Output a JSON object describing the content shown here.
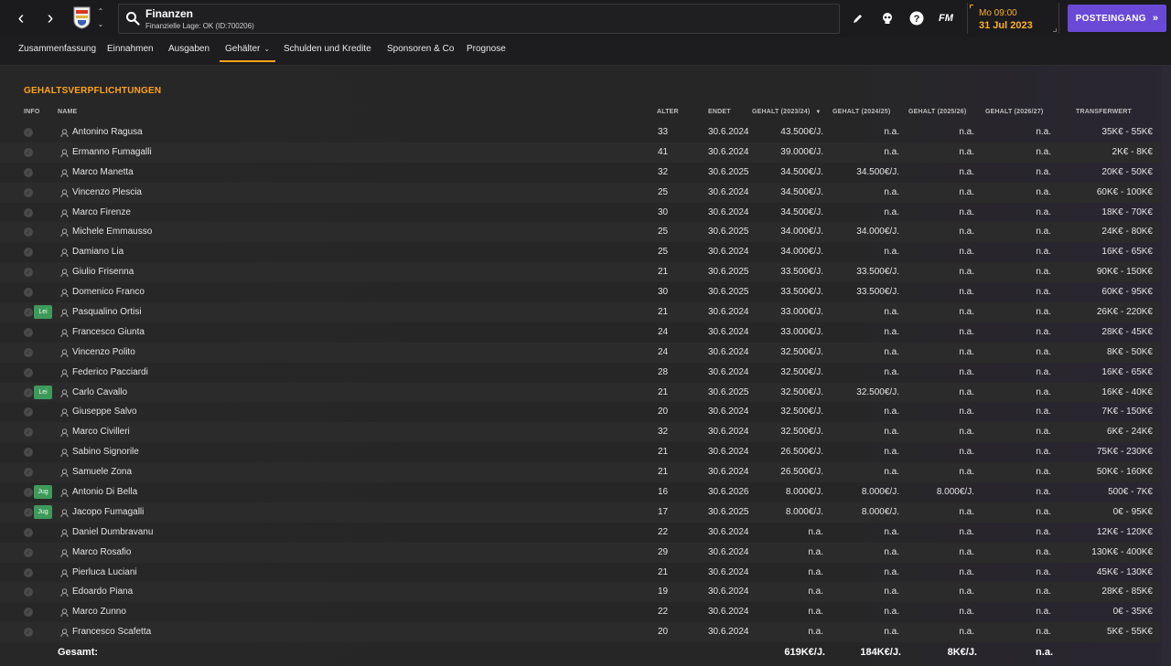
{
  "header": {
    "title": "Finanzen",
    "subtitle": "Finanzielle Lage: OK (ID:700206)",
    "date_time": "Mo 09:00",
    "date_day": "31 Jul 2023",
    "inbox_label": "POSTEINGANG",
    "fm_logo": "FM",
    "accent_color": "#ffa31a",
    "button_color": "#6a49d6"
  },
  "tabs": [
    {
      "label": "Zusammenfassung"
    },
    {
      "label": "Einnahmen"
    },
    {
      "label": "Ausgaben"
    },
    {
      "label": "Gehälter",
      "active": true
    },
    {
      "label": "Schulden und Kredite"
    },
    {
      "label": "Sponsoren & Co"
    },
    {
      "label": "Prognose"
    }
  ],
  "section_title": "GEHALTSVERPFLICHTUNGEN",
  "columns": {
    "info": "INFO",
    "name": "NAME",
    "age": "ALTER",
    "ends": "ENDET",
    "salary1": "GEHALT (2023/24)",
    "salary2": "GEHALT (2024/25)",
    "salary3": "GEHALT (2025/26)",
    "salary4": "GEHALT (2026/27)",
    "transfer": "TRANSFERWERT"
  },
  "players": [
    {
      "badge": "",
      "name": "Antonino Ragusa",
      "age": "33",
      "ends": "30.6.2024",
      "s1": "43.500€/J.",
      "s2": "n.a.",
      "s3": "n.a.",
      "s4": "n.a.",
      "tv": "35K€ - 55K€"
    },
    {
      "badge": "",
      "name": "Ermanno Fumagalli",
      "age": "41",
      "ends": "30.6.2024",
      "s1": "39.000€/J.",
      "s2": "n.a.",
      "s3": "n.a.",
      "s4": "n.a.",
      "tv": "2K€ - 8K€"
    },
    {
      "badge": "",
      "name": "Marco Manetta",
      "age": "32",
      "ends": "30.6.2025",
      "s1": "34.500€/J.",
      "s2": "34.500€/J.",
      "s3": "n.a.",
      "s4": "n.a.",
      "tv": "20K€ - 50K€"
    },
    {
      "badge": "",
      "name": "Vincenzo Plescia",
      "age": "25",
      "ends": "30.6.2024",
      "s1": "34.500€/J.",
      "s2": "n.a.",
      "s3": "n.a.",
      "s4": "n.a.",
      "tv": "60K€ - 100K€"
    },
    {
      "badge": "",
      "name": "Marco Firenze",
      "age": "30",
      "ends": "30.6.2024",
      "s1": "34.500€/J.",
      "s2": "n.a.",
      "s3": "n.a.",
      "s4": "n.a.",
      "tv": "18K€ - 70K€"
    },
    {
      "badge": "",
      "name": "Michele Emmausso",
      "age": "25",
      "ends": "30.6.2025",
      "s1": "34.000€/J.",
      "s2": "34.000€/J.",
      "s3": "n.a.",
      "s4": "n.a.",
      "tv": "24K€ - 80K€"
    },
    {
      "badge": "",
      "name": "Damiano Lia",
      "age": "25",
      "ends": "30.6.2024",
      "s1": "34.000€/J.",
      "s2": "n.a.",
      "s3": "n.a.",
      "s4": "n.a.",
      "tv": "16K€ - 65K€"
    },
    {
      "badge": "",
      "name": "Giulio Frisenna",
      "age": "21",
      "ends": "30.6.2025",
      "s1": "33.500€/J.",
      "s2": "33.500€/J.",
      "s3": "n.a.",
      "s4": "n.a.",
      "tv": "90K€ - 150K€"
    },
    {
      "badge": "",
      "name": "Domenico Franco",
      "age": "30",
      "ends": "30.6.2025",
      "s1": "33.500€/J.",
      "s2": "33.500€/J.",
      "s3": "n.a.",
      "s4": "n.a.",
      "tv": "60K€ - 95K€"
    },
    {
      "badge": "Lei",
      "name": "Pasqualino Ortisi",
      "age": "21",
      "ends": "30.6.2024",
      "s1": "33.000€/J.",
      "s2": "n.a.",
      "s3": "n.a.",
      "s4": "n.a.",
      "tv": "26K€ - 220K€"
    },
    {
      "badge": "",
      "name": "Francesco Giunta",
      "age": "24",
      "ends": "30.6.2024",
      "s1": "33.000€/J.",
      "s2": "n.a.",
      "s3": "n.a.",
      "s4": "n.a.",
      "tv": "28K€ - 45K€"
    },
    {
      "badge": "",
      "name": "Vincenzo Polito",
      "age": "24",
      "ends": "30.6.2024",
      "s1": "32.500€/J.",
      "s2": "n.a.",
      "s3": "n.a.",
      "s4": "n.a.",
      "tv": "8K€ - 50K€"
    },
    {
      "badge": "",
      "name": "Federico Pacciardi",
      "age": "28",
      "ends": "30.6.2024",
      "s1": "32.500€/J.",
      "s2": "n.a.",
      "s3": "n.a.",
      "s4": "n.a.",
      "tv": "16K€ - 65K€"
    },
    {
      "badge": "Lei",
      "name": "Carlo Cavallo",
      "age": "21",
      "ends": "30.6.2025",
      "s1": "32.500€/J.",
      "s2": "32.500€/J.",
      "s3": "n.a.",
      "s4": "n.a.",
      "tv": "16K€ - 40K€"
    },
    {
      "badge": "",
      "name": "Giuseppe Salvo",
      "age": "20",
      "ends": "30.6.2024",
      "s1": "32.500€/J.",
      "s2": "n.a.",
      "s3": "n.a.",
      "s4": "n.a.",
      "tv": "7K€ - 150K€"
    },
    {
      "badge": "",
      "name": "Marco Civilleri",
      "age": "32",
      "ends": "30.6.2024",
      "s1": "32.500€/J.",
      "s2": "n.a.",
      "s3": "n.a.",
      "s4": "n.a.",
      "tv": "6K€ - 24K€"
    },
    {
      "badge": "",
      "name": "Sabino Signorile",
      "age": "21",
      "ends": "30.6.2024",
      "s1": "26.500€/J.",
      "s2": "n.a.",
      "s3": "n.a.",
      "s4": "n.a.",
      "tv": "75K€ - 230K€"
    },
    {
      "badge": "",
      "name": "Samuele Zona",
      "age": "21",
      "ends": "30.6.2024",
      "s1": "26.500€/J.",
      "s2": "n.a.",
      "s3": "n.a.",
      "s4": "n.a.",
      "tv": "50K€ - 160K€"
    },
    {
      "badge": "Jug",
      "name": "Antonio Di Bella",
      "age": "16",
      "ends": "30.6.2026",
      "s1": "8.000€/J.",
      "s2": "8.000€/J.",
      "s3": "8.000€/J.",
      "s4": "n.a.",
      "tv": "500€ - 7K€"
    },
    {
      "badge": "Jug",
      "name": "Jacopo Fumagalli",
      "age": "17",
      "ends": "30.6.2025",
      "s1": "8.000€/J.",
      "s2": "8.000€/J.",
      "s3": "n.a.",
      "s4": "n.a.",
      "tv": "0€ - 95K€"
    },
    {
      "badge": "",
      "name": "Daniel Dumbravanu",
      "age": "22",
      "ends": "30.6.2024",
      "s1": "n.a.",
      "s2": "n.a.",
      "s3": "n.a.",
      "s4": "n.a.",
      "tv": "12K€ - 120K€"
    },
    {
      "badge": "",
      "name": "Marco Rosafio",
      "age": "29",
      "ends": "30.6.2024",
      "s1": "n.a.",
      "s2": "n.a.",
      "s3": "n.a.",
      "s4": "n.a.",
      "tv": "130K€ - 400K€"
    },
    {
      "badge": "",
      "name": "Pierluca Luciani",
      "age": "21",
      "ends": "30.6.2024",
      "s1": "n.a.",
      "s2": "n.a.",
      "s3": "n.a.",
      "s4": "n.a.",
      "tv": "45K€ - 130K€"
    },
    {
      "badge": "",
      "name": "Edoardo Piana",
      "age": "19",
      "ends": "30.6.2024",
      "s1": "n.a.",
      "s2": "n.a.",
      "s3": "n.a.",
      "s4": "n.a.",
      "tv": "28K€ - 85K€"
    },
    {
      "badge": "",
      "name": "Marco Zunno",
      "age": "22",
      "ends": "30.6.2024",
      "s1": "n.a.",
      "s2": "n.a.",
      "s3": "n.a.",
      "s4": "n.a.",
      "tv": "0€ - 35K€"
    },
    {
      "badge": "",
      "name": "Francesco Scafetta",
      "age": "20",
      "ends": "30.6.2024",
      "s1": "n.a.",
      "s2": "n.a.",
      "s3": "n.a.",
      "s4": "n.a.",
      "tv": "5K€ - 55K€"
    }
  ],
  "totals": {
    "label": "Gesamt:",
    "s1": "619K€/J.",
    "s2": "184K€/J.",
    "s3": "8K€/J.",
    "s4": "n.a."
  }
}
